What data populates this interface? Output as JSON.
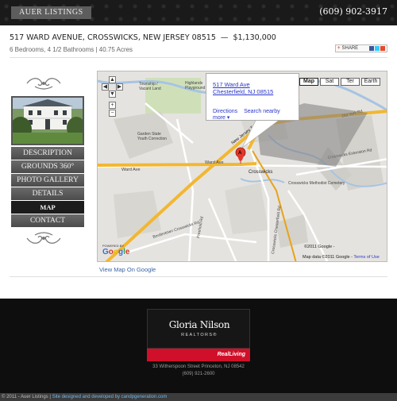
{
  "header": {
    "brand": "AUER LISTINGS",
    "phone": "(609) 902-3917"
  },
  "listing": {
    "address": "517 WARD AVENUE, CROSSWICKS, NEW JERSEY 08515",
    "separator": "—",
    "price": "$1,130,000",
    "details": "6 Bedrooms, 4 1/2 Bathrooms  |  40.75 Acres",
    "share_label": "SHARE"
  },
  "menu": {
    "items": [
      {
        "label": "DESCRIPTION",
        "active": false
      },
      {
        "label": "GROUNDS 360°",
        "active": false
      },
      {
        "label": "PHOTO GALLERY",
        "active": false
      },
      {
        "label": "DETAILS",
        "active": false
      },
      {
        "label": "MAP",
        "active": true
      },
      {
        "label": "CONTACT",
        "active": false
      }
    ]
  },
  "map": {
    "types": [
      "Map",
      "Sat",
      "Ter",
      "Earth"
    ],
    "active_type": "Map",
    "info_line1": "517 Ward Ave",
    "info_line2": "Chesterfield, NJ 08515",
    "link_directions": "Directions",
    "link_search": "Search nearby",
    "link_more": "more ▾",
    "marker_label": "A",
    "copyright": "©2011 Google -",
    "map_data": "Map data ©2011 Google -",
    "terms": "Terms of Use",
    "powered_by": "POWERED BY",
    "google": "Google",
    "place_labels": {
      "township": "Township /",
      "vacant": "Vacant Land",
      "highlands": "Highlands",
      "playground": "Playground",
      "garden_state": "Garden State",
      "youth": "Youth Correction",
      "new_jersey_tpk": "New Jersey Turnpike",
      "old_york": "Old York Rd",
      "ward_ave": "Ward Ave",
      "ward_ave2": "Ward Ave",
      "crosswicks": "Crosswicks",
      "chesterfield_rd": "Crosswicks Chesterfield Rd",
      "methodist": "Crosswicks Methodist Cemetery",
      "ext_rd": "Crosswicks Extension Rd",
      "bordentown": "Bordentown Crosswicks Rd",
      "freehold": "Freehold Rd"
    },
    "view_link": "View Map On Google"
  },
  "footer": {
    "logo_name": "Gloria Nilson",
    "logo_sub": "REALTORS®",
    "logo_brand": "RealLiving",
    "address": "33 Witherspoon Street Princeton, NJ 08542",
    "phone": "(609) 921-2600",
    "copyright": "© 2011 - Auer Listings | ",
    "credit": "Site designed and developed by candpgeneration.com"
  },
  "colors": {
    "header_bg": "#1a1a1a",
    "menu_bg": "#5a5a5a",
    "menu_active": "#1c1c1c",
    "road_yellow": "#f2b731",
    "water_blue": "#a6c4e4",
    "link_blue": "#2a37c8",
    "logo_red": "#d0102a"
  }
}
